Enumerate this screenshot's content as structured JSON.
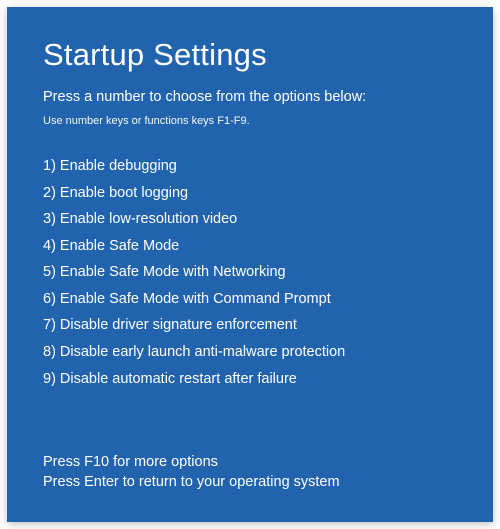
{
  "title": "Startup Settings",
  "subtitle": "Press a number to choose from the options below:",
  "hint": "Use number keys or functions keys F1-F9.",
  "options": [
    "1) Enable debugging",
    "2) Enable boot logging",
    "3) Enable low-resolution video",
    "4) Enable Safe Mode",
    "5) Enable Safe Mode with Networking",
    "6) Enable Safe Mode with Command Prompt",
    "7) Disable driver signature enforcement",
    "8) Disable early launch anti-malware protection",
    "9) Disable automatic restart after failure"
  ],
  "footer": {
    "more": "Press F10 for more options",
    "return": "Press Enter to return to your operating system"
  }
}
